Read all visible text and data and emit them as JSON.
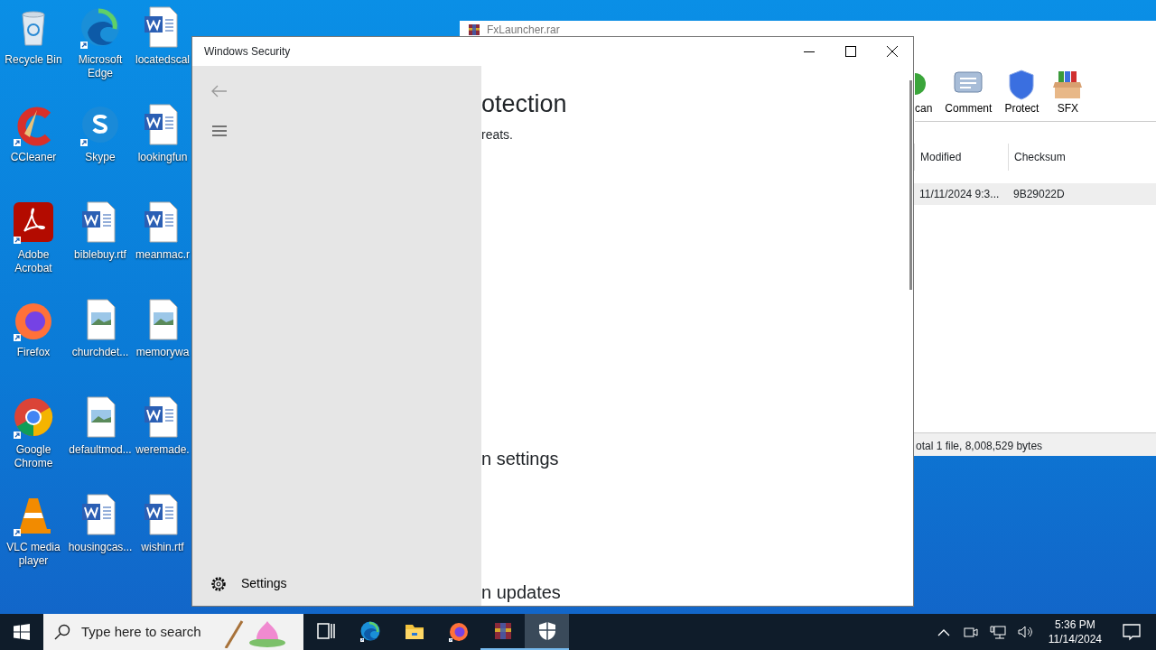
{
  "desktop_icons": [
    {
      "label": "Recycle Bin",
      "kind": "recycle"
    },
    {
      "label": "CCleaner",
      "kind": "ccleaner"
    },
    {
      "label": "Adobe Acrobat",
      "kind": "acrobat"
    },
    {
      "label": "Firefox",
      "kind": "firefox"
    },
    {
      "label": "Google Chrome",
      "kind": "chrome"
    },
    {
      "label": "VLC media player",
      "kind": "vlc"
    },
    {
      "label": "Microsoft Edge",
      "kind": "edge"
    },
    {
      "label": "Skype",
      "kind": "skype"
    },
    {
      "label": "biblebuy.rtf",
      "kind": "word"
    },
    {
      "label": "churchdet...",
      "kind": "image"
    },
    {
      "label": "defaultmod...",
      "kind": "image"
    },
    {
      "label": "housingcas...",
      "kind": "word"
    },
    {
      "label": "locatedscal",
      "kind": "word"
    },
    {
      "label": "lookingfun",
      "kind": "word"
    },
    {
      "label": "meanmac.r",
      "kind": "word"
    },
    {
      "label": "memorywa",
      "kind": "image"
    },
    {
      "label": "weremade.",
      "kind": "word"
    },
    {
      "label": "wishin.rtf",
      "kind": "word"
    }
  ],
  "archive_window": {
    "title": "FxLauncher.rar",
    "toolbar": [
      {
        "label": "can",
        "kind": "scan"
      },
      {
        "label": "Comment",
        "kind": "comment"
      },
      {
        "label": "Protect",
        "kind": "protect"
      },
      {
        "label": "SFX",
        "kind": "sfx"
      }
    ],
    "columns": [
      "Modified",
      "Checksum"
    ],
    "rows": [
      {
        "cells": [
          "11/11/2024 9:3...",
          "9B29022D"
        ],
        "selected": true
      }
    ],
    "status_bar": "otal 1 file, 8,008,529 bytes"
  },
  "security_window": {
    "title": "Windows Security",
    "nav": [
      {
        "label": "Settings",
        "kind": "settings"
      }
    ],
    "heading": "otection",
    "subtitle": "reats.",
    "sections": [
      "n settings",
      "n updates"
    ]
  },
  "taskbar": {
    "search": {
      "placeholder": "Type here to search"
    },
    "apps": [
      {
        "kind": "taskview",
        "selected": false,
        "running": false
      },
      {
        "kind": "edge",
        "selected": false,
        "running": false
      },
      {
        "kind": "explorer",
        "selected": false,
        "running": false
      },
      {
        "kind": "firefox",
        "selected": false,
        "running": false
      },
      {
        "kind": "winrar",
        "selected": false,
        "running": true
      },
      {
        "kind": "security",
        "selected": true,
        "running": true
      }
    ],
    "time": "5:36 PM",
    "date": "11/14/2024"
  }
}
